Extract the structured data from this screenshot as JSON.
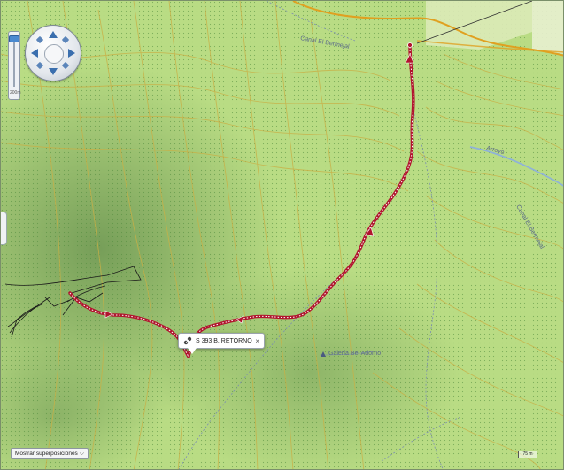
{
  "map": {
    "labels": {
      "canal_top": "Canal El Bermejal",
      "canal_right": "Canal El Bermejal",
      "arroyo": "Arroyo",
      "galeria": "Galería Bel Adorno"
    },
    "track": {
      "name": "S 393 B. RETORNO",
      "color": "#b0152e"
    },
    "colors": {
      "background": "#b9dc84",
      "contour": "#c9b046",
      "canal": "#e0a020",
      "hillshade": "#6d8f5a"
    }
  },
  "controls": {
    "zoom": {
      "scale_text": "200m"
    },
    "pan": {
      "up_icon": "arrow-up-icon",
      "down_icon": "arrow-down-icon",
      "left_icon": "arrow-left-icon",
      "right_icon": "arrow-right-icon"
    }
  },
  "popup": {
    "title": "S 393 B. RETORNO",
    "icon": "track-icon",
    "close_label": "×"
  },
  "overlay_select": {
    "label": "Mostrar superposiciones",
    "chevron": "⌵"
  },
  "scale": {
    "label": "75 m"
  }
}
